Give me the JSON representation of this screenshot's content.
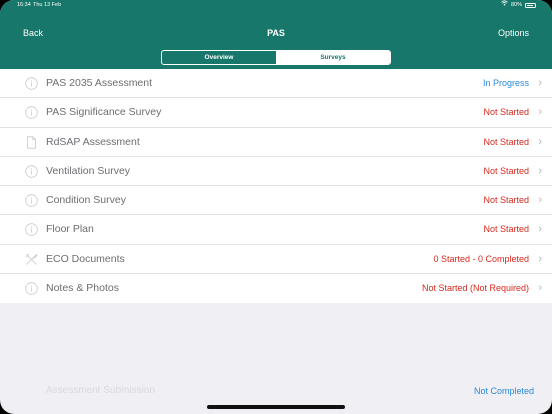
{
  "status_bar": {
    "time": "16:34",
    "date": "Thu 13 Feb",
    "battery_percent": "80%"
  },
  "nav": {
    "back_label": "Back",
    "title": "PAS",
    "options_label": "Options"
  },
  "tabs": [
    {
      "label": "Overview",
      "active": false
    },
    {
      "label": "Surveys",
      "active": true
    }
  ],
  "surveys": [
    {
      "label": "PAS 2035 Assessment",
      "status": "In Progress",
      "status_color": "#2b8ad6",
      "icon": "info-icon"
    },
    {
      "label": "PAS Significance Survey",
      "status": "Not Started",
      "status_color": "#d6291e",
      "icon": "info-icon"
    },
    {
      "label": "RdSAP Assessment",
      "status": "Not Started",
      "status_color": "#d6291e",
      "icon": "document-icon"
    },
    {
      "label": "Ventilation Survey",
      "status": "Not Started",
      "status_color": "#d6291e",
      "icon": "info-icon"
    },
    {
      "label": "Condition Survey",
      "status": "Not Started",
      "status_color": "#d6291e",
      "icon": "info-icon"
    },
    {
      "label": "Floor Plan",
      "status": "Not Started",
      "status_color": "#d6291e",
      "icon": "info-icon"
    },
    {
      "label": "ECO Documents",
      "status": "0 Started - 0 Completed",
      "status_color": "#d6291e",
      "icon": "tools-icon"
    },
    {
      "label": "Notes & Photos",
      "status": "Not Started (Not Required)",
      "status_color": "#d6291e",
      "icon": "info-icon"
    }
  ],
  "submission": {
    "label": "Assessment Submission",
    "status": "Not Completed"
  },
  "colors": {
    "header": "#16776a",
    "in_progress": "#2b8ad6",
    "not_started": "#d6291e"
  }
}
